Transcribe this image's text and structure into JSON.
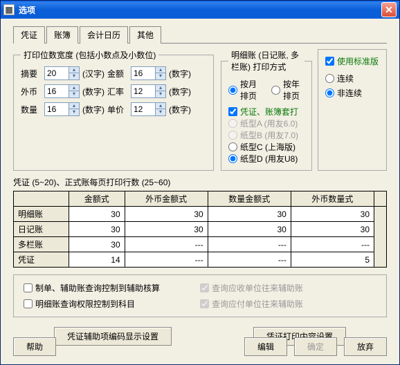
{
  "window": {
    "title": "选项"
  },
  "tabs": {
    "items": [
      "凭证",
      "账簿",
      "会计日历",
      "其他"
    ],
    "active": 1
  },
  "fsWidth": {
    "legend": "打印位数宽度 (包括小数点及小数位)",
    "rows": [
      {
        "l1": "摘要",
        "v1": "20",
        "u1": "(汉字)",
        "l2": "金额",
        "v2": "16",
        "u2": "(数字)"
      },
      {
        "l1": "外币",
        "v1": "16",
        "u1": "(数字)",
        "l2": "汇率",
        "v2": "12",
        "u2": "(数字)"
      },
      {
        "l1": "数量",
        "v1": "16",
        "u1": "(数字)",
        "l2": "单价",
        "v2": "12",
        "u2": "(数字)"
      }
    ]
  },
  "fsDetail": {
    "legend": "明细账 (日记账, 多栏账) 打印方式",
    "optMonth": "按月排页",
    "optYear": "按年排页",
    "chkSet": "凭证、账簿套打",
    "paperA": "纸型A (用友6.0)",
    "paperB": "纸型B (用友7.0)",
    "paperC": "纸型C (上海版)",
    "paperD": "纸型D (用友U8)"
  },
  "fsStd": {
    "chk": "使用标准版",
    "optCont": "连续",
    "optNonCont": "非连续"
  },
  "table": {
    "caption": "凭证 (5~20)、正式账每页打印行数 (25~60)",
    "headers": [
      "",
      "金额式",
      "外币金额式",
      "数量金额式",
      "外币数量式"
    ],
    "rows": [
      {
        "h": "明细账",
        "c": [
          "30",
          "30",
          "30",
          "30"
        ]
      },
      {
        "h": "日记账",
        "c": [
          "30",
          "30",
          "30",
          "30"
        ]
      },
      {
        "h": "多栏账",
        "c": [
          "30",
          "---",
          "---",
          "---"
        ]
      },
      {
        "h": "凭证",
        "c": [
          "14",
          "---",
          "---",
          "5"
        ]
      }
    ]
  },
  "checks": {
    "c1": "制单、辅助账查询控制到辅助核算",
    "c2": "明细账查询权限控制到科目",
    "c3": "查询应收单位往来辅助账",
    "c4": "查询应付单位往来辅助账"
  },
  "btns": {
    "aux": "凭证辅助项编码显示设置",
    "print": "凭证打印内容设置",
    "help": "帮助",
    "edit": "编辑",
    "ok": "确定",
    "cancel": "放弃"
  }
}
